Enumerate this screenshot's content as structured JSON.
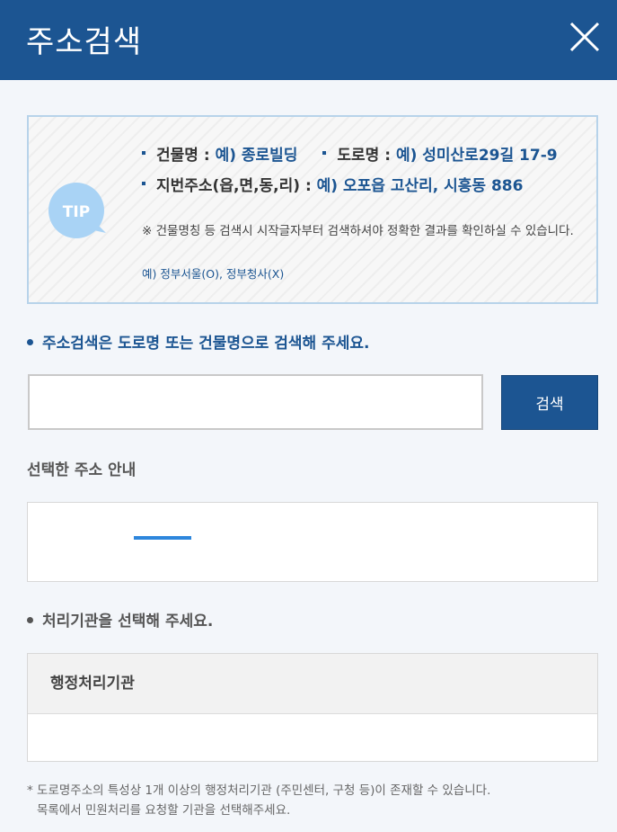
{
  "header": {
    "title": "주소검색",
    "close_icon": "close-icon"
  },
  "tip": {
    "badge": "TIP",
    "line1_label1": "건물명 : ",
    "line1_value1": "예) 종로빌딩",
    "line1_label2": "도로명 : ",
    "line1_value2": "예) 성미산로29길 17-9",
    "line2_label": "지번주소(읍,면,동,리) : ",
    "line2_value": "예) 오포읍 고산리, 시흥동 886",
    "note": "※ 건물명칭 등 검색시 시작글자부터 검색하셔야 정확한 결과를 확인하실 수 있습니다.",
    "example": "예) 정부서울(O), 정부청사(X)"
  },
  "search": {
    "guide": "주소검색은 도로명 또는 건물명으로 검색해 주세요.",
    "value": "",
    "button_label": "검색"
  },
  "selected": {
    "title": "선택한 주소 안내",
    "zip": "",
    "road_tag": "",
    "road_address": "",
    "jibun_tag": "",
    "jibun_address": ""
  },
  "agency": {
    "guide": "처리기관을 선택해 주세요.",
    "column_header": "행정처리기관",
    "rows": [
      ""
    ]
  },
  "footnote": {
    "line1": "* 도로명주소의 특성상 1개 이상의 행정처리기관 (주민센터, 구청 등)이 존재할 수 있습니다.",
    "line2": "목록에서 민원처리를 요청할 기관을 선택해주세요."
  },
  "colors": {
    "primary": "#1c5592",
    "tip_bubble": "#a9d3f5",
    "tip_border": "#b7d3ea"
  }
}
